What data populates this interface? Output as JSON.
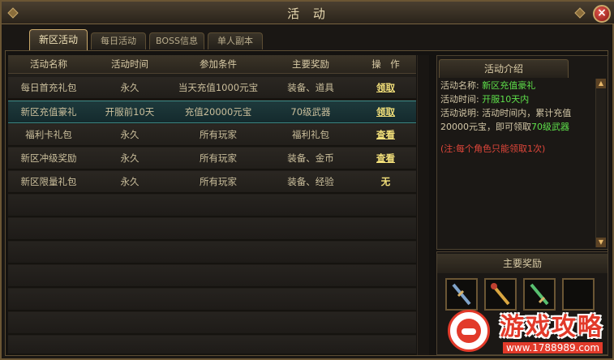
{
  "window": {
    "title": "活 动",
    "close_label": "×"
  },
  "tabs": [
    {
      "label": "新区活动",
      "active": true
    },
    {
      "label": "每日活动",
      "active": false
    },
    {
      "label": "BOSS信息",
      "active": false
    },
    {
      "label": "单人副本",
      "active": false
    }
  ],
  "table": {
    "headers": [
      "活动名称",
      "活动时间",
      "参加条件",
      "主要奖励",
      "操　作"
    ],
    "rows": [
      {
        "name": "每日首充礼包",
        "time": "永久",
        "condition": "当天充值1000元宝",
        "reward": "装备、道具",
        "action": "领取",
        "selected": false
      },
      {
        "name": "新区充值豪礼",
        "time": "开服前10天",
        "condition": "充值20000元宝",
        "reward": "70级武器",
        "action": "领取",
        "selected": true
      },
      {
        "name": "福利卡礼包",
        "time": "永久",
        "condition": "所有玩家",
        "reward": "福利礼包",
        "action": "查看",
        "selected": false
      },
      {
        "name": "新区冲级奖励",
        "time": "永久",
        "condition": "所有玩家",
        "reward": "装备、金币",
        "action": "查看",
        "selected": false
      },
      {
        "name": "新区限量礼包",
        "time": "永久",
        "condition": "所有玩家",
        "reward": "装备、经验",
        "action": "无",
        "selected": false
      }
    ]
  },
  "info": {
    "tab_label": "活动介绍",
    "name_label": "活动名称:",
    "name_value": "新区充值豪礼",
    "time_label": "活动时间:",
    "time_value": "开服10天内",
    "desc_label": "活动说明:",
    "desc_text": "活动时间内，累计充值20000元宝，即可领取",
    "desc_highlight": "70级武器",
    "note": "(注:每个角色只能领取1次)"
  },
  "rewards": {
    "title": "主要奖励",
    "items": [
      {
        "icon": "sword-icon",
        "color": "#7fa3c9"
      },
      {
        "icon": "staff-icon",
        "color": "#d9a640"
      },
      {
        "icon": "blade-icon",
        "color": "#58c070"
      },
      {
        "icon": "empty-slot",
        "color": "#2a2622"
      }
    ]
  },
  "watermark": {
    "text": "游戏攻略",
    "url": "www.1788989.com"
  },
  "colors": {
    "accent_gold": "#c9a86a",
    "highlight_green": "#5ee04a",
    "note_red": "#e0463a",
    "action_yellow": "#f3e07a"
  }
}
